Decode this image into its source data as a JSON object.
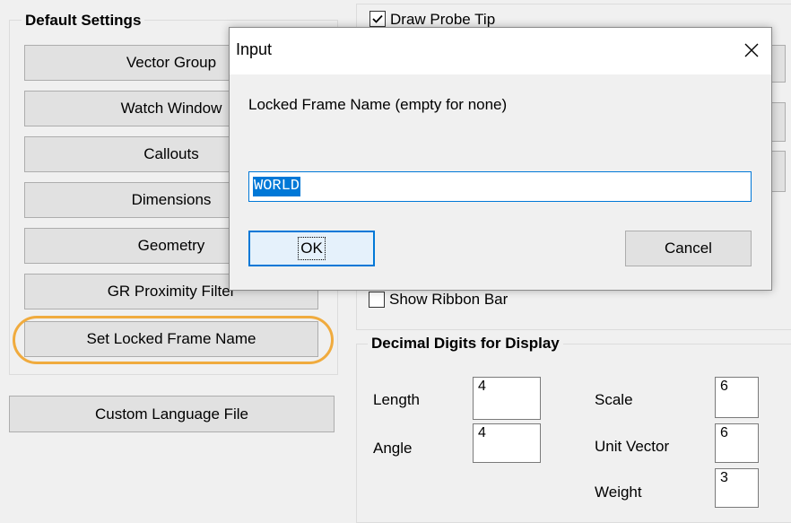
{
  "left_panel": {
    "group_title": "Default Settings",
    "buttons": [
      "Vector Group",
      "Watch Window",
      "Callouts",
      "Dimensions",
      "Geometry",
      "GR Proximity Filter",
      "Set Locked Frame Name"
    ],
    "custom_language_button": "Custom Language File"
  },
  "right_panel": {
    "draw_probe_tip_label": "Draw Probe Tip",
    "draw_probe_tip_checked": true,
    "show_ribbon_bar_label": "Show Ribbon Bar",
    "show_ribbon_bar_checked": false,
    "decimal_group_title": "Decimal Digits for Display",
    "length_label": "Length",
    "length_value": "4",
    "angle_label": "Angle",
    "angle_value": "4",
    "scale_label": "Scale",
    "scale_value": "6",
    "unit_vector_label": "Unit Vector",
    "unit_vector_value": "6",
    "weight_label": "Weight",
    "weight_value": "3"
  },
  "dialog": {
    "title": "Input",
    "close_icon": "close-icon",
    "prompt": "Locked Frame Name (empty for none)",
    "input_value": "WORLD",
    "ok_label": "OK",
    "cancel_label": "Cancel"
  },
  "colors": {
    "accent": "#0078d7",
    "highlight_ring": "#f0ab3e"
  }
}
